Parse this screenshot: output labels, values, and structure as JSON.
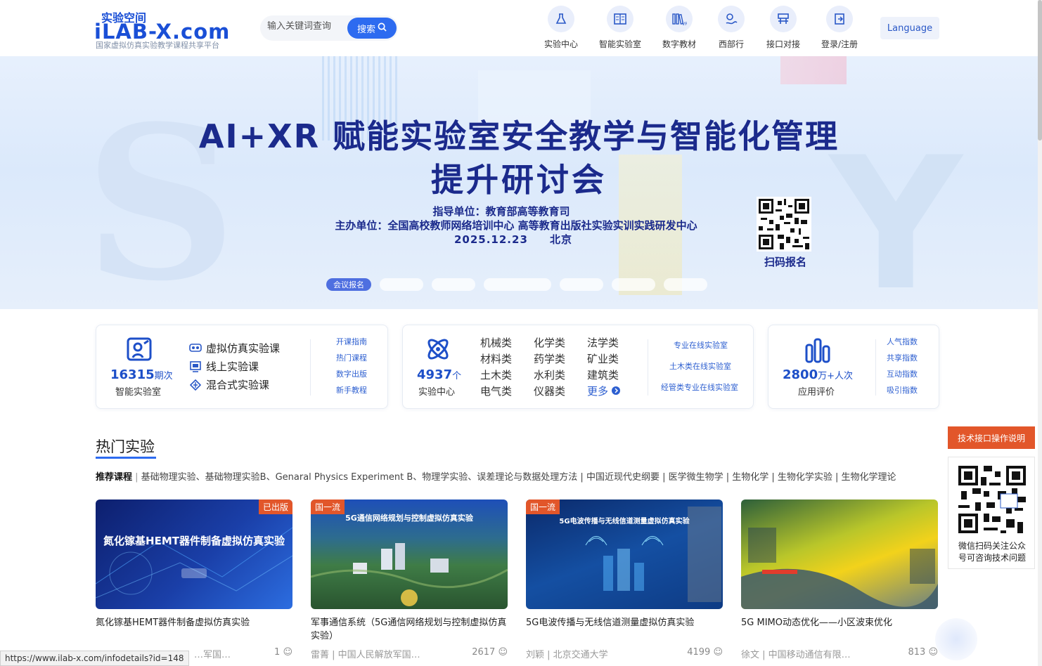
{
  "logo": {
    "cn": "实验空间",
    "en": "iLAB-X.com",
    "sub": "国家虚拟仿真实验教学课程共享平台"
  },
  "search": {
    "placeholder": "输入关键词查询",
    "button": "搜索"
  },
  "nav": [
    {
      "label": "实验中心",
      "icon": "flask-icon"
    },
    {
      "label": "智能实验室",
      "icon": "book-icon"
    },
    {
      "label": "数字教材",
      "icon": "vr-books-icon"
    },
    {
      "label": "西部行",
      "icon": "location-icon"
    },
    {
      "label": "接口对接",
      "icon": "interface-icon"
    },
    {
      "label": "登录/注册",
      "icon": "login-icon"
    }
  ],
  "language": "Language",
  "banner": {
    "title1": "AI+XR 赋能实验室安全教学与智能化管理",
    "title2": "提升研讨会",
    "sub1": "指导单位：教育部高等教育司",
    "sub2": "主办单位：全国高校教师网络培训中心 高等教育出版社实验实训实践研发中心",
    "sub3": "2025.12.23     北京",
    "qr_label": "扫码报名",
    "active_dot": "会议报名"
  },
  "stats": {
    "lab": {
      "number": "16315",
      "unit": "期次",
      "caption": "智能实验室",
      "rows": [
        "虚拟仿真实验课",
        "线上实验课",
        "混合式实验课"
      ],
      "links": [
        "开课指南",
        "热门课程",
        "数字出版",
        "新手教程"
      ]
    },
    "center": {
      "number": "4937",
      "unit": "个",
      "caption": "实验中心",
      "cats": [
        "机械类",
        "化学类",
        "法学类",
        "材料类",
        "药学类",
        "矿业类",
        "土木类",
        "水利类",
        "建筑类",
        "电气类",
        "仪器类",
        "更多"
      ],
      "links": [
        "专业在线实验室",
        "土木类在线实验室",
        "经管类专业在线实验室"
      ]
    },
    "eval": {
      "number": "2800",
      "unit": "万+人次",
      "caption": "应用评价",
      "links": [
        "人气指数",
        "共享指数",
        "互动指数",
        "吸引指数"
      ]
    }
  },
  "hot": {
    "title": "热门实验",
    "recommend_label": "推荐课程",
    "recommend_items": "基础物理实验、基础物理实验B、Genaral Physics Experiment B、物理学实验、误差理论与数据处理方法 | 中国近现代史纲要 | 医学微生物学 | 生物化学 | 生物化学实验 | 生物化学理论",
    "experiments": [
      {
        "tag": "已出版",
        "thumb_text": "氮化镓基HEMT器件制备虚拟仿真实验",
        "name": "氮化镓基HEMT器件制备虚拟仿真实验",
        "author": "",
        "org": "…军国…",
        "count": "1"
      },
      {
        "tag": "国一流",
        "thumb_text": "5G通信网络规划与控制虚拟仿真实验",
        "name": "军事通信系统（5G通信网络规划与控制虚拟仿真实验）",
        "author": "雷菁",
        "org": "中国人民解放军国…",
        "count": "2617"
      },
      {
        "tag": "国一流",
        "thumb_text": "5G电波传播与无线信道测量虚拟仿真实验",
        "name": "5G电波传播与无线信道测量虚拟仿真实验",
        "author": "刘颖",
        "org": "北京交通大学",
        "count": "4199"
      },
      {
        "tag": "",
        "thumb_text": "",
        "name": "5G MIMO动态优化——小区波束优化",
        "author": "徐文",
        "org": "中国移动通信有限…",
        "count": "813"
      }
    ]
  },
  "float": {
    "button": "技术接口操作说明",
    "qr_text1": "微信扫码关注公众",
    "qr_text2": "号可咨询技术问题"
  },
  "status_url": "https://www.ilab-x.com/infodetails?id=148"
}
